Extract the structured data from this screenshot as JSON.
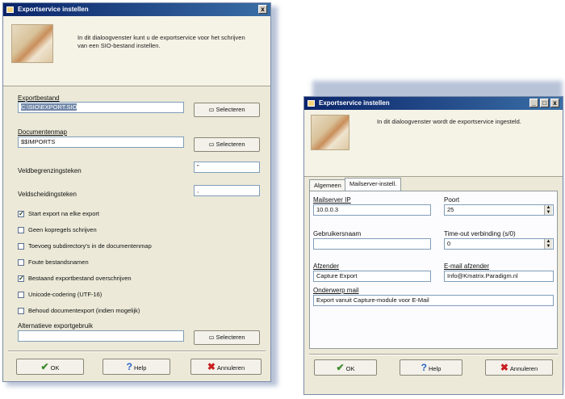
{
  "left_dialog": {
    "title": "Exportservice instellen",
    "close_label": "x",
    "description": "In dit dialoogvenster kunt u de exportservice voor het schrijven van een SIO-bestand instellen.",
    "export_file_label": "Exportbestand",
    "export_file_value": "C:\\SIO\\EXPORT.SIO",
    "document_folder_label": "Documentenmap",
    "document_folder_value": "$$IMPORTS",
    "select_label": "Selecteren",
    "field_separator_label": "Veldbegrenzingsteken",
    "field_separator_value": "\"",
    "field_delimiter_label": "Veldscheidingsteken",
    "field_delimiter_value": ",",
    "checkboxes": [
      {
        "label": "Start export na elke export",
        "checked": "✓"
      },
      {
        "label": "Geen kopregels schrijven",
        "checked": ""
      },
      {
        "label": "Toevoeg subdirectory's in de documentenmap",
        "checked": ""
      },
      {
        "label": "Foute bestandsnamen",
        "checked": ""
      },
      {
        "label": "Bestaand exportbestand overschrijven",
        "checked": "✓"
      },
      {
        "label": "Unicode-codering (UTF-16)",
        "checked": ""
      },
      {
        "label": "Behoud documentexport (indien mogelijk)",
        "checked": ""
      }
    ],
    "alt_export_label": "Alternatieve exportgebruik",
    "ok_label": "OK",
    "help_label": "Help",
    "cancel_label": "Annuleren"
  },
  "right_dialog": {
    "title": "Exportservice instellen",
    "min_label": "_",
    "max_label": "□",
    "close_label": "x",
    "description": "In dit dialoogvenster wordt de exportservice ingesteld.",
    "tabs": [
      "Algemeen",
      "Mailserver-instell."
    ],
    "mailserver_ip_label": "Mailserver IP",
    "mailserver_ip_value": "10.0.0.3",
    "port_label": "Poort",
    "port_value": "25",
    "pop_user_label": "Gebruikersnaam",
    "pop_user_value": "",
    "timeout_label": "Time-out verbinding (s/0)",
    "timeout_value": "0",
    "sender_label": "Afzender",
    "sender_value": "Capture Export",
    "sender_email_label": "E-mail afzender",
    "sender_email_value": "Info@Kmatrix.Paradigm.nl",
    "subject_label": "Onderwerp mail",
    "subject_value": "Export vanuit Capture-module voor E-Mail",
    "ok_label": "OK",
    "help_label": "Help",
    "cancel_label": "Annuleren"
  }
}
